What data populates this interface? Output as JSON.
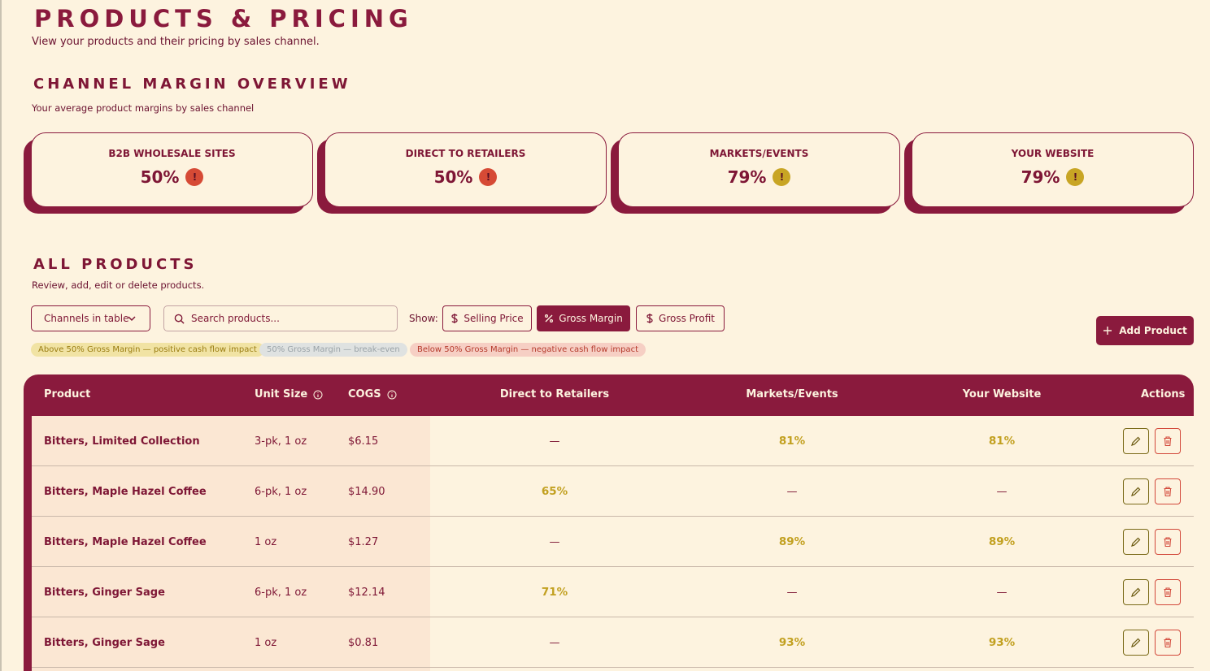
{
  "header": {
    "title": "PRODUCTS & PRICING",
    "subtitle": "View your products and their pricing by sales channel."
  },
  "overview": {
    "title": "CHANNEL MARGIN OVERVIEW",
    "subtitle": "Your average product margins by sales channel",
    "cards": [
      {
        "label": "B2B WHOLESALE SITES",
        "value": "50%",
        "indicator": "!",
        "indicator_color": "#d64a35"
      },
      {
        "label": "DIRECT TO RETAILERS",
        "value": "50%",
        "indicator": "!",
        "indicator_color": "#d64a35"
      },
      {
        "label": "MARKETS/EVENTS",
        "value": "79%",
        "indicator": "!",
        "indicator_color": "#c8a524"
      },
      {
        "label": "YOUR WEBSITE",
        "value": "79%",
        "indicator": "!",
        "indicator_color": "#c8a524"
      }
    ]
  },
  "products": {
    "title": "ALL PRODUCTS",
    "subtitle": "Review, add, edit or delete products.",
    "channels_select": "Channels in table",
    "search_placeholder": "Search products...",
    "show_label": "Show:",
    "toggles": [
      {
        "label": "Selling Price",
        "icon": "dollar-icon",
        "active": false
      },
      {
        "label": "Gross Margin",
        "icon": "percent-icon",
        "active": true
      },
      {
        "label": "Gross Profit",
        "icon": "dollar-icon",
        "active": false
      }
    ],
    "add_button": "Add Product",
    "legend": [
      {
        "label": "Above 50% Gross Margin — positive cash flow impact",
        "bg": "#f1e3a4",
        "fg": "#9a7d12"
      },
      {
        "label": "50% Gross Margin — break-even",
        "bg": "#dfe2e1",
        "fg": "#9aa3a8"
      },
      {
        "label": "Below 50% Gross Margin — negative cash flow impact",
        "bg": "#f6cfc4",
        "fg": "#b53a2c"
      }
    ],
    "columns": {
      "product": "Product",
      "unit_size": "Unit Size",
      "cogs": "COGS",
      "direct": "Direct to Retailers",
      "markets": "Markets/Events",
      "website": "Your Website",
      "actions": "Actions"
    },
    "rows": [
      {
        "product": "Bitters, Limited Collection",
        "unit_size": "3-pk, 1 oz",
        "cogs": "$6.15",
        "direct": "—",
        "markets": "81%",
        "website": "81%"
      },
      {
        "product": "Bitters, Maple Hazel Coffee",
        "unit_size": "6-pk, 1 oz",
        "cogs": "$14.90",
        "direct": "65%",
        "markets": "—",
        "website": "—"
      },
      {
        "product": "Bitters, Maple Hazel Coffee",
        "unit_size": "1 oz",
        "cogs": "$1.27",
        "direct": "—",
        "markets": "89%",
        "website": "89%"
      },
      {
        "product": "Bitters, Ginger Sage",
        "unit_size": "6-pk, 1 oz",
        "cogs": "$12.14",
        "direct": "71%",
        "markets": "—",
        "website": "—"
      },
      {
        "product": "Bitters, Ginger Sage",
        "unit_size": "1 oz",
        "cogs": "$0.81",
        "direct": "—",
        "markets": "93%",
        "website": "93%"
      }
    ]
  }
}
